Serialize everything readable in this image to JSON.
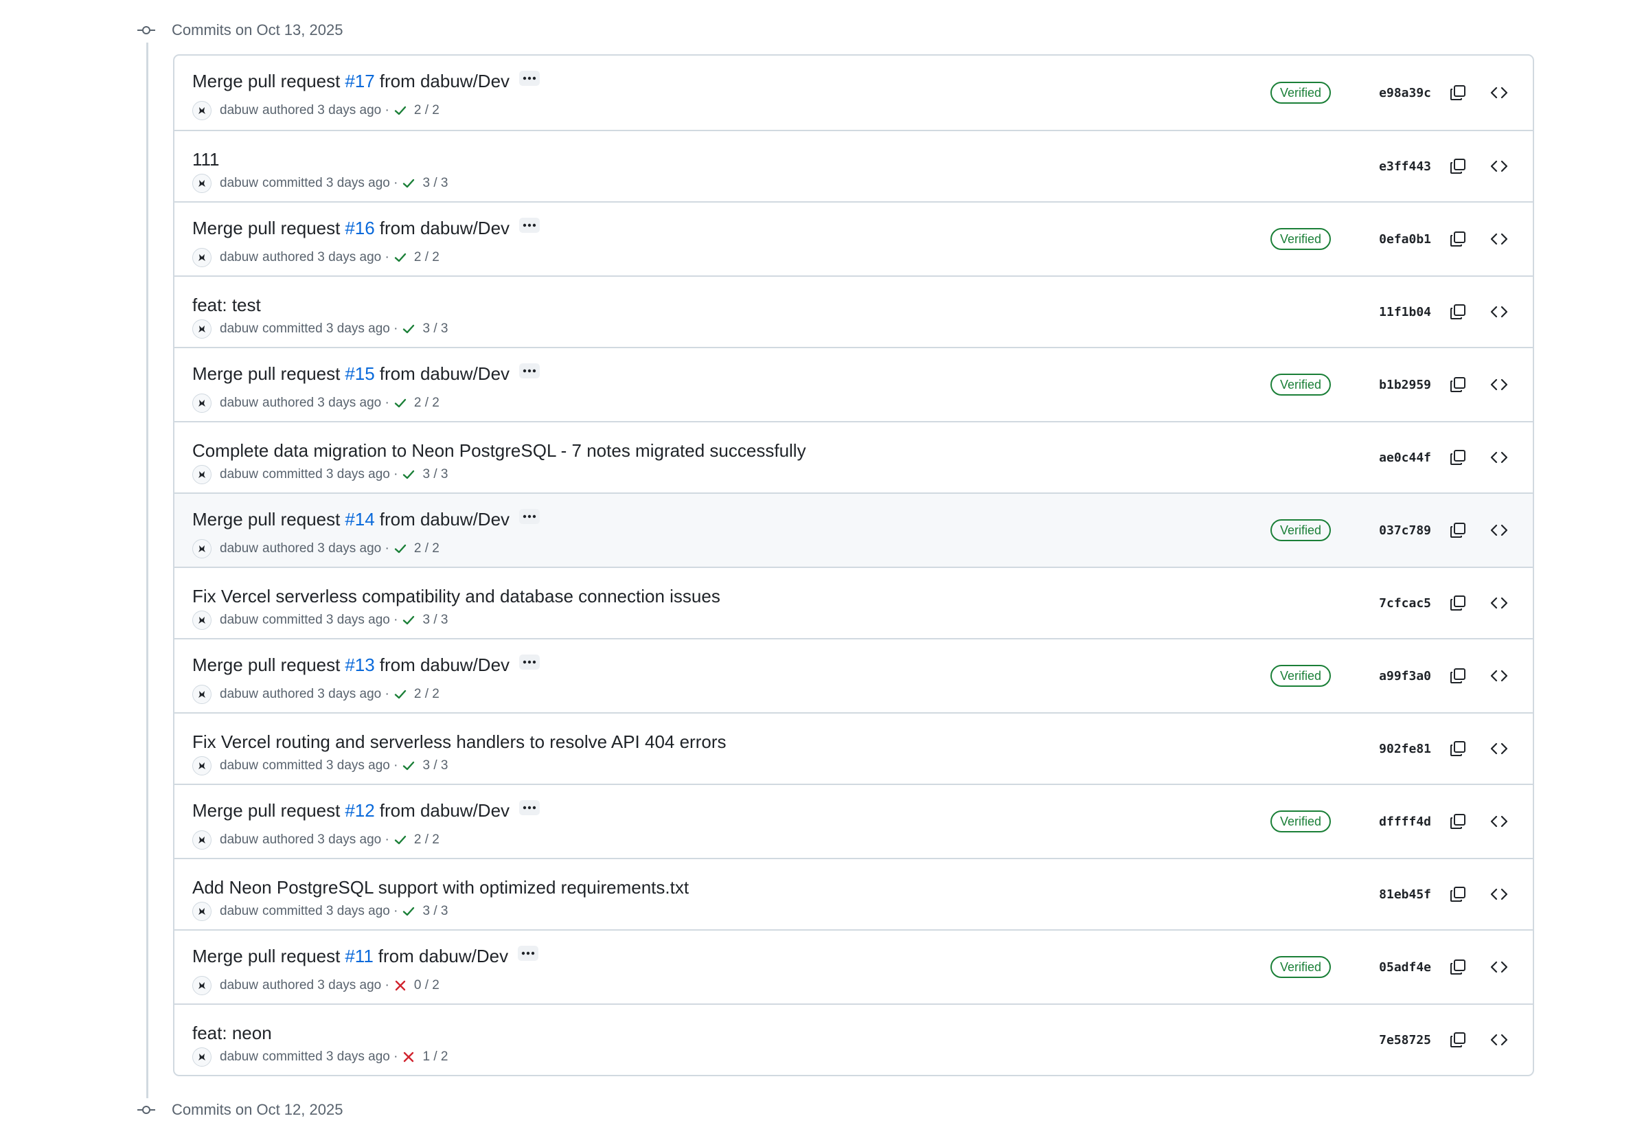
{
  "day_groups": [
    {
      "title": "Commits on Oct 13, 2025"
    },
    {
      "title": "Commits on Oct 12, 2025"
    }
  ],
  "commits": [
    {
      "kind": "merge",
      "title_prefix": "Merge pull request",
      "pr": "#17",
      "title_suffix": "from dabuw/Dev",
      "author": "dabuw",
      "action": "authored 3 days ago ·",
      "status": "success",
      "checks": "2 / 2",
      "verified": "Verified",
      "sha": "e98a39c"
    },
    {
      "kind": "plain",
      "title": "111",
      "author": "dabuw",
      "action": "committed 3 days ago ·",
      "status": "success",
      "checks": "3 / 3",
      "sha": "e3ff443"
    },
    {
      "kind": "merge",
      "title_prefix": "Merge pull request",
      "pr": "#16",
      "title_suffix": "from dabuw/Dev",
      "author": "dabuw",
      "action": "authored 3 days ago ·",
      "status": "success",
      "checks": "2 / 2",
      "verified": "Verified",
      "sha": "0efa0b1"
    },
    {
      "kind": "plain",
      "title": "feat: test",
      "author": "dabuw",
      "action": "committed 3 days ago ·",
      "status": "success",
      "checks": "3 / 3",
      "sha": "11f1b04"
    },
    {
      "kind": "merge",
      "title_prefix": "Merge pull request",
      "pr": "#15",
      "title_suffix": "from dabuw/Dev",
      "author": "dabuw",
      "action": "authored 3 days ago ·",
      "status": "success",
      "checks": "2 / 2",
      "verified": "Verified",
      "sha": "b1b2959"
    },
    {
      "kind": "plain",
      "title": "Complete data migration to Neon PostgreSQL - 7 notes migrated successfully",
      "author": "dabuw",
      "action": "committed 3 days ago ·",
      "status": "success",
      "checks": "3 / 3",
      "sha": "ae0c44f"
    },
    {
      "kind": "merge",
      "title_prefix": "Merge pull request",
      "pr": "#14",
      "title_suffix": "from dabuw/Dev",
      "author": "dabuw",
      "action": "authored 3 days ago ·",
      "status": "success",
      "checks": "2 / 2",
      "verified": "Verified",
      "sha": "037c789",
      "hover": true
    },
    {
      "kind": "plain",
      "title": "Fix Vercel serverless compatibility and database connection issues",
      "author": "dabuw",
      "action": "committed 3 days ago ·",
      "status": "success",
      "checks": "3 / 3",
      "sha": "7cfcac5"
    },
    {
      "kind": "merge",
      "title_prefix": "Merge pull request",
      "pr": "#13",
      "title_suffix": "from dabuw/Dev",
      "author": "dabuw",
      "action": "authored 3 days ago ·",
      "status": "success",
      "checks": "2 / 2",
      "verified": "Verified",
      "sha": "a99f3a0"
    },
    {
      "kind": "plain",
      "title": "Fix Vercel routing and serverless handlers to resolve API 404 errors",
      "author": "dabuw",
      "action": "committed 3 days ago ·",
      "status": "success",
      "checks": "3 / 3",
      "sha": "902fe81"
    },
    {
      "kind": "merge",
      "title_prefix": "Merge pull request",
      "pr": "#12",
      "title_suffix": "from dabuw/Dev",
      "author": "dabuw",
      "action": "authored 3 days ago ·",
      "status": "success",
      "checks": "2 / 2",
      "verified": "Verified",
      "sha": "dffff4d"
    },
    {
      "kind": "plain",
      "title": "Add Neon PostgreSQL support with optimized requirements.txt",
      "author": "dabuw",
      "action": "committed 3 days ago ·",
      "status": "success",
      "checks": "3 / 3",
      "sha": "81eb45f"
    },
    {
      "kind": "merge",
      "title_prefix": "Merge pull request",
      "pr": "#11",
      "title_suffix": "from dabuw/Dev",
      "author": "dabuw",
      "action": "authored 3 days ago ·",
      "status": "failure",
      "checks": "0 / 2",
      "verified": "Verified",
      "sha": "05adf4e"
    },
    {
      "kind": "plain",
      "title": "feat: neon",
      "author": "dabuw",
      "action": "committed 3 days ago ·",
      "status": "failure",
      "checks": "1 / 2",
      "sha": "7e58725"
    }
  ],
  "icons": {
    "commit": "git-commit-icon",
    "copy": "copy-icon",
    "browse": "code-icon",
    "ellipsis": "ellipsis-icon",
    "success": "check-icon",
    "failure": "x-icon"
  },
  "colors": {
    "link": "#0969da",
    "success": "#1a7f37",
    "failure": "#d1242f",
    "muted": "#59636e",
    "border": "#d1d9e0"
  }
}
